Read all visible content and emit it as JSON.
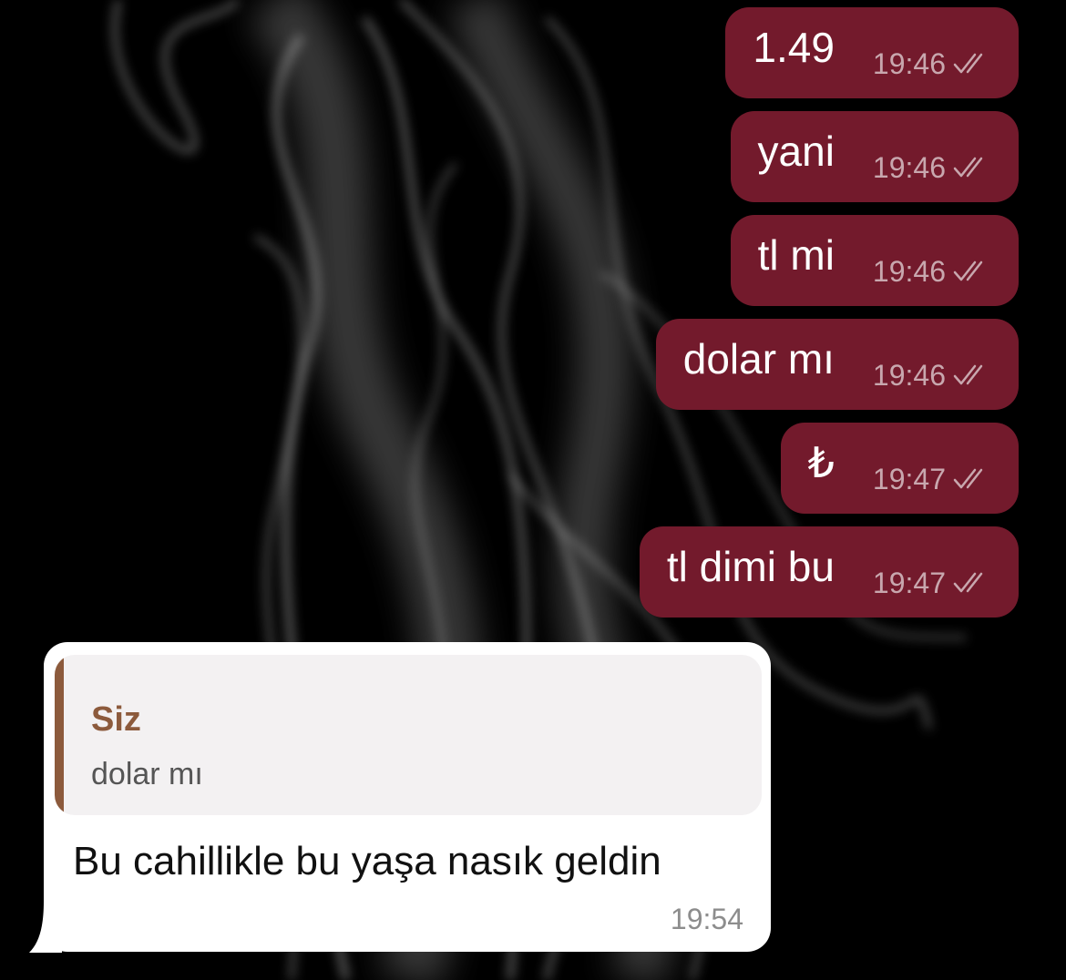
{
  "chat": {
    "outgoing": [
      {
        "text": "1.49",
        "time": "19:46",
        "status": "read-double-check-icon"
      },
      {
        "text": "yani",
        "time": "19:46",
        "status": "read-double-check-icon"
      },
      {
        "text": "tl mi",
        "time": "19:46",
        "status": "read-double-check-icon"
      },
      {
        "text": "dolar mı",
        "time": "19:46",
        "status": "read-double-check-icon"
      },
      {
        "text": "₺",
        "time": "19:47",
        "status": "read-double-check-icon"
      },
      {
        "text": "tl dimi bu",
        "time": "19:47",
        "status": "read-double-check-icon"
      }
    ],
    "incoming": {
      "reply": {
        "author": "Siz",
        "text": "dolar mı"
      },
      "text": "Bu cahillikle bu yaşa nasık geldin",
      "time": "19:54"
    }
  },
  "colors": {
    "outgoing_bubble": "#731a2c",
    "incoming_bubble": "#ffffff",
    "reply_accent": "#8c5a3c",
    "background": "#000000"
  }
}
